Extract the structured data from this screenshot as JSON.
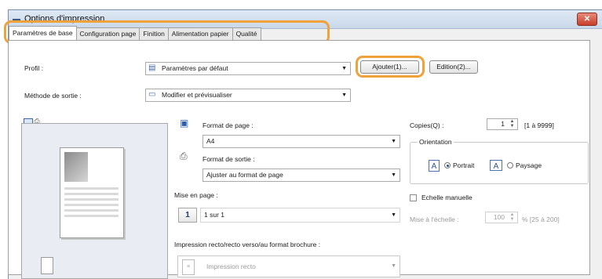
{
  "window": {
    "title": "Options d'impression",
    "close_glyph": "✕"
  },
  "tabs": [
    "Paramètres de base",
    "Configuration page",
    "Finition",
    "Alimentation papier",
    "Qualité"
  ],
  "profile": {
    "label": "Profil :",
    "value": "Paramètres par défaut",
    "add_button": "Ajouter(1)...",
    "edit_button": "Edition(2)..."
  },
  "output_method": {
    "label": "Méthode de sortie :",
    "value": "Modifier et prévisualiser"
  },
  "page_size": {
    "label": "Format de page :",
    "value": "A4"
  },
  "output_size": {
    "label": "Format de sortie :",
    "value": "Ajuster au format de page"
  },
  "layout": {
    "label": "Mise en page :",
    "value": "1 sur 1",
    "icon_text": "1"
  },
  "duplex": {
    "label": "Impression recto/recto verso/au format brochure :",
    "value": "Impression recto"
  },
  "copies": {
    "label": "Copies(Q) :",
    "value": "1",
    "range": "[1 à 9999]"
  },
  "orientation": {
    "title": "Orientation",
    "portrait": "Portrait",
    "landscape": "Paysage",
    "selected": "Portrait"
  },
  "manual_scaling": {
    "label": "Echelle manuelle",
    "checked": false
  },
  "scaling": {
    "label": "Mise à l'échelle :",
    "value": "100",
    "range": "% [25 à 200]"
  },
  "colors": {
    "highlight": "#f0a13a"
  },
  "icons": [
    "printer-icon",
    "close-icon",
    "profile-icon",
    "output-method-icon",
    "page-size-icon",
    "output-size-icon",
    "layout-icon",
    "duplex-icon",
    "page-view-icon",
    "printer-view-icon",
    "orientation-portrait-icon",
    "orientation-landscape-icon"
  ]
}
